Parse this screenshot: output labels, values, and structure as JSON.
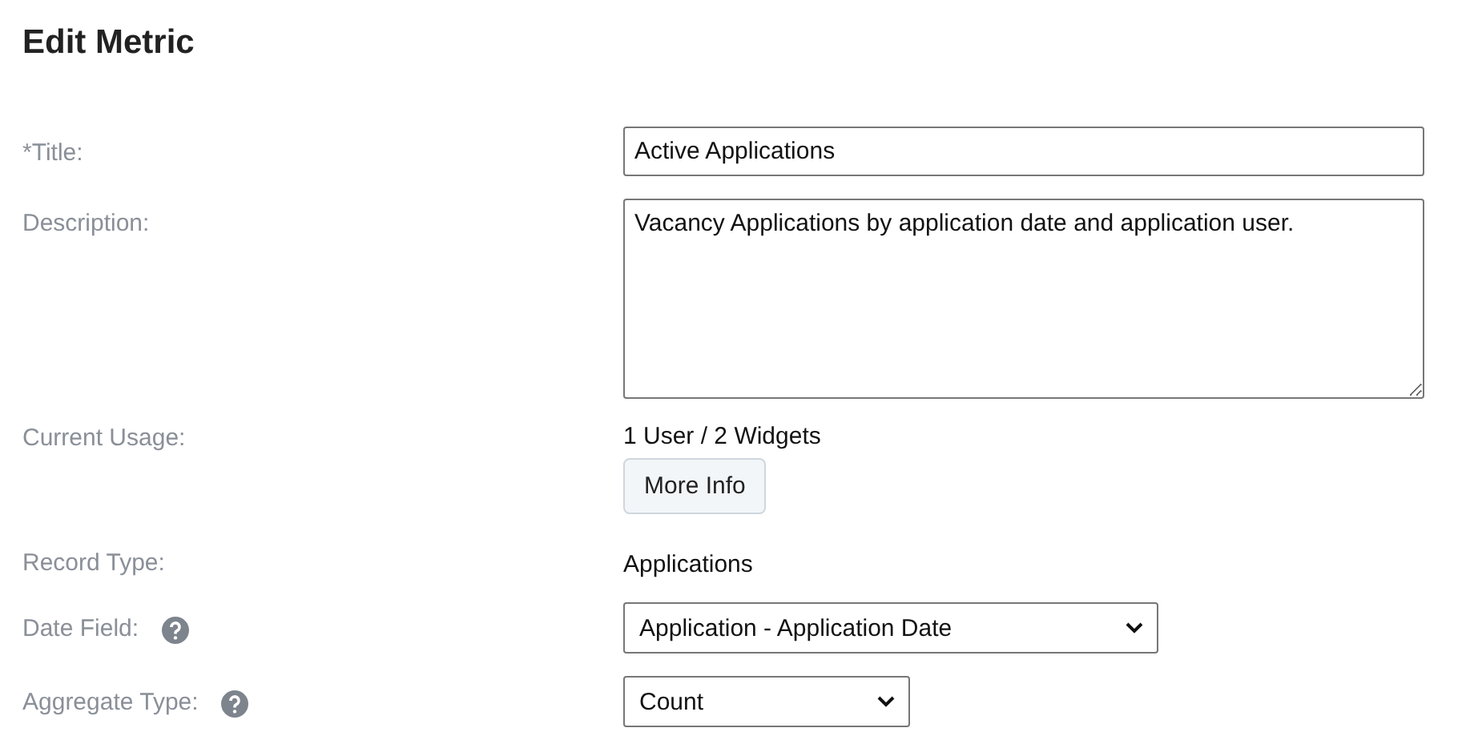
{
  "heading": "Edit Metric",
  "fields": [
    {
      "kind": "text",
      "label": "*Title:",
      "help": false,
      "value": "Active Applications"
    },
    {
      "kind": "textarea",
      "label": "Description:",
      "help": false,
      "value": "Vacancy Applications by application date and application user."
    },
    {
      "kind": "usage",
      "label": "Current Usage:",
      "help": false,
      "value": "1 User / 2 Widgets",
      "button": "More Info"
    },
    {
      "kind": "static",
      "label": "Record Type:",
      "help": false,
      "value": "Applications"
    },
    {
      "kind": "select",
      "label": "Date Field:",
      "help": true,
      "value": "Application - Application Date"
    },
    {
      "kind": "select",
      "label": "Aggregate Type:",
      "help": true,
      "value": "Count"
    }
  ]
}
